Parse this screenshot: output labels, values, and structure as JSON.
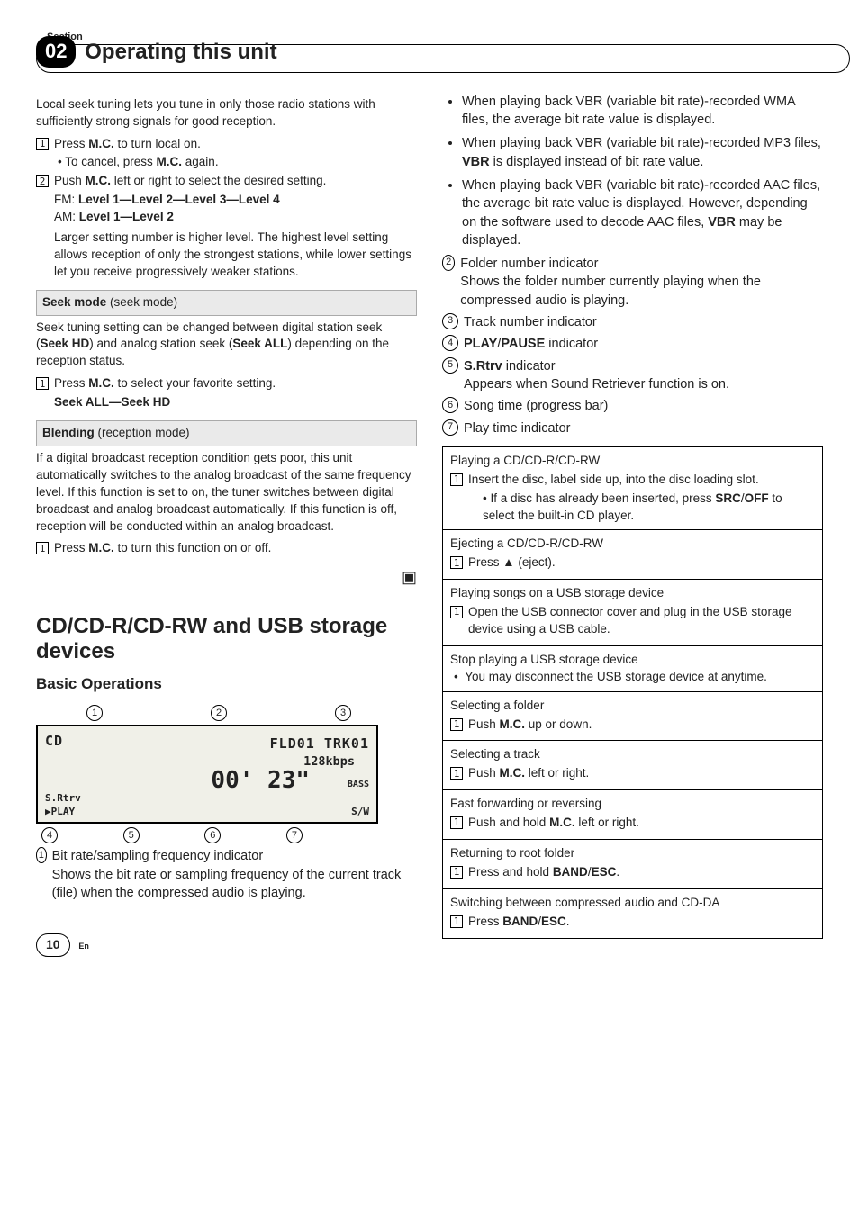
{
  "section_label": "Section",
  "chapter_number": "02",
  "chapter_title": "Operating this unit",
  "left": {
    "local_seek_intro": "Local seek tuning lets you tune in only those radio stations with sufficiently strong signals for good reception.",
    "step1_a": "Press ",
    "step1_mc": "M.C.",
    "step1_b": " to turn local on.",
    "step1_sub_a": "To cancel, press ",
    "step1_sub_b": " again.",
    "step2_a": "Push ",
    "step2_b": " left or right to select the desired setting.",
    "fm_levels_label": "FM: ",
    "fm_levels": "Level 1—Level 2—Level 3—Level 4",
    "am_levels_label": "AM: ",
    "am_levels": "Level 1—Level 2",
    "levels_desc": "Larger setting number is higher level. The highest level setting allows reception of only the strongest stations, while lower settings let you receive progressively weaker stations.",
    "seek_head_bold": "Seek mode",
    "seek_head_paren": " (seek mode)",
    "seek_body_a": "Seek tuning setting can be changed between digital station seek (",
    "seek_hd": "Seek HD",
    "seek_body_b": ") and analog station seek (",
    "seek_all": "Seek ALL",
    "seek_body_c": ") depending on the reception status.",
    "seek_step_a": "Press ",
    "seek_step_b": " to select your favorite setting.",
    "seek_opts": "Seek ALL—Seek HD",
    "blend_head_bold": "Blending",
    "blend_head_paren": " (reception mode)",
    "blend_body": "If a digital broadcast reception condition gets poor, this unit automatically switches to the analog broadcast of the same frequency level. If this function is set to on, the tuner switches between digital broadcast and analog broadcast automatically. If this function is off, reception will be conducted within an analog broadcast.",
    "blend_step_a": "Press ",
    "blend_step_b": " to turn this function on or off.",
    "h2": "CD/CD-R/CD-RW and USB storage devices",
    "h3": "Basic Operations",
    "display": {
      "cd": "CD",
      "top": "FLD01 TRK01",
      "mid": "128kbps",
      "big": "00' 23\"",
      "bass": "BASS",
      "srtrv": "S.Rtrv",
      "play": "PLAY",
      "sw": "S/W"
    },
    "ind1_a": "Bit rate/sampling frequency indicator",
    "ind1_b": "Shows the bit rate or sampling frequency of the current track (file) when the compressed audio is playing."
  },
  "right": {
    "b1_a": "When playing back VBR (variable bit rate)-recorded WMA files, the average bit rate value is displayed.",
    "b2_a": "When playing back VBR (variable bit rate)-recorded MP3 files, ",
    "b2_bold": "VBR",
    "b2_b": " is displayed instead of bit rate value.",
    "b3_a": "When playing back VBR (variable bit rate)-recorded AAC files, the average bit rate value is displayed. However, depending on the software used to decode AAC files, ",
    "b3_bold": "VBR",
    "b3_b": " may be displayed.",
    "ind2_a": "Folder number indicator",
    "ind2_b": "Shows the folder number currently playing when the compressed audio is playing.",
    "ind3": "Track number indicator",
    "ind4_a": "PLAY",
    "ind4_slash": "/",
    "ind4_b": "PAUSE",
    "ind4_c": " indicator",
    "ind5_a": "S.Rtrv",
    "ind5_b": " indicator",
    "ind5_c": "Appears when Sound Retriever function is on.",
    "ind6": "Song time (progress bar)",
    "ind7": "Play time indicator",
    "box": {
      "s1_t": "Playing a CD/CD-R/CD-RW",
      "s1_1": "Insert the disc, label side up, into the disc loading slot.",
      "s1_sub_a": "If a disc has already been inserted, press ",
      "s1_sub_b": "SRC",
      "s1_sub_c": "/",
      "s1_sub_d": "OFF",
      "s1_sub_e": " to select the built-in CD player.",
      "s2_t": "Ejecting a CD/CD-R/CD-RW",
      "s2_1": "Press ▲ (eject).",
      "s3_t": "Playing songs on a USB storage device",
      "s3_1": "Open the USB connector cover and plug in the USB storage device using a USB cable.",
      "s4_t": "Stop playing a USB storage device",
      "s4_1": "You may disconnect the USB storage device at anytime.",
      "s5_t": "Selecting a folder",
      "s5_1a": "Push ",
      "s5_1b": " up or down.",
      "s6_t": "Selecting a track",
      "s6_1a": "Push ",
      "s6_1b": " left or right.",
      "s7_t": "Fast forwarding or reversing",
      "s7_1a": "Push and hold ",
      "s7_1b": " left or right.",
      "s8_t": "Returning to root folder",
      "s8_1a": "Press and hold ",
      "s8_1b": "BAND",
      "s8_1c": "/",
      "s8_1d": "ESC",
      "s8_1e": ".",
      "s9_t": "Switching between compressed audio and CD-DA",
      "s9_1a": "Press ",
      "s9_1b": "BAND",
      "s9_1c": "/",
      "s9_1d": "ESC",
      "s9_1e": "."
    }
  },
  "page_number": "10",
  "page_lang": "En",
  "mc": "M.C."
}
